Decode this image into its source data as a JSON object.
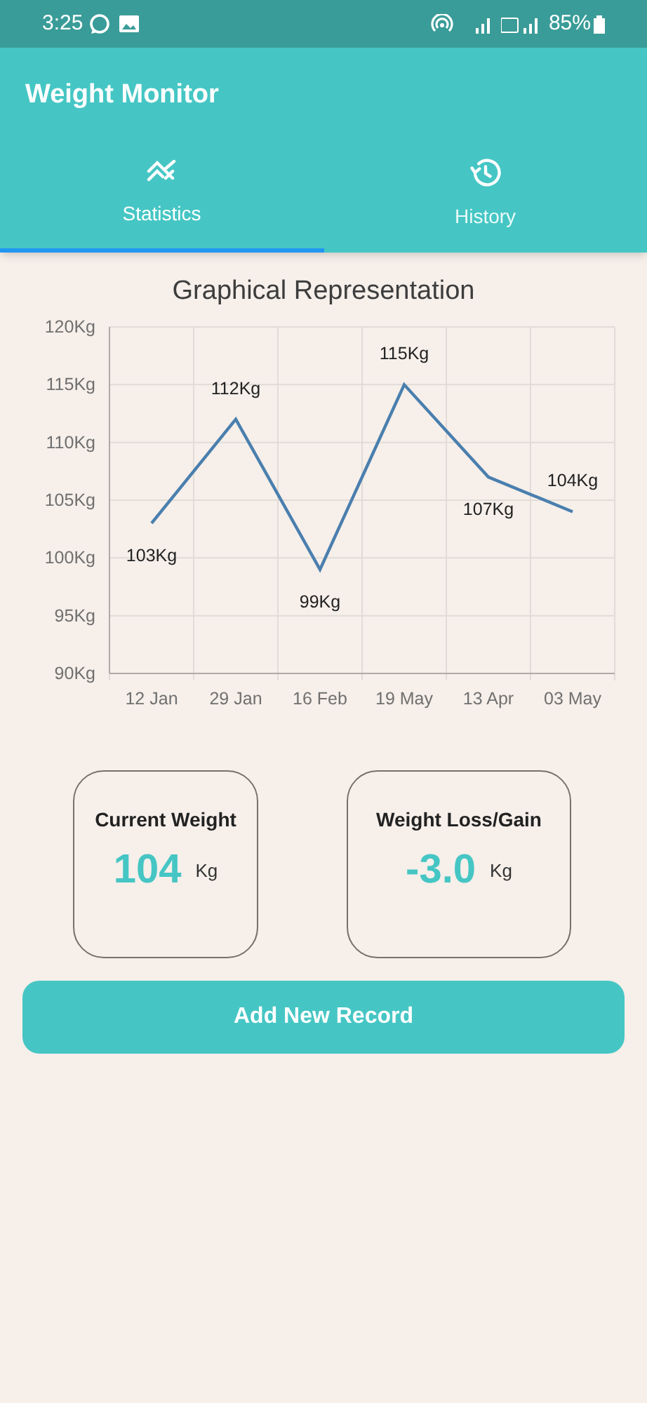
{
  "status_bar": {
    "time": "3:25",
    "battery": "85%"
  },
  "app_bar": {
    "title": "Weight Monitor"
  },
  "tabs": [
    {
      "label": "Statistics",
      "selected": true
    },
    {
      "label": "History",
      "selected": false
    }
  ],
  "chart_data": {
    "type": "line",
    "title": "Graphical Representation",
    "categories": [
      "12 Jan",
      "29 Jan",
      "16 Feb",
      "19 May",
      "13 Apr",
      "03 May"
    ],
    "series": [
      {
        "color": "#4a7fae",
        "values": [
          103,
          112,
          99,
          115,
          107,
          104
        ]
      }
    ],
    "grid": true,
    "ylim": [
      90,
      120
    ],
    "yticks": [
      {
        "value": 90,
        "label": "90Kg"
      },
      {
        "value": 95,
        "label": "95Kg"
      },
      {
        "value": 100,
        "label": "100Kg"
      },
      {
        "value": 105,
        "label": "105Kg"
      },
      {
        "value": 110,
        "label": "110Kg"
      },
      {
        "value": 115,
        "label": "115Kg"
      },
      {
        "value": 120,
        "label": "120Kg"
      }
    ],
    "value_labels": [
      "103Kg",
      "112Kg",
      "99Kg",
      "115Kg",
      "107Kg",
      "104Kg"
    ]
  },
  "cards": [
    {
      "title": "Current Weight",
      "value": "104",
      "unit": "Kg"
    },
    {
      "title": "Weight Loss/Gain",
      "value": "-3.0",
      "unit": "Kg"
    }
  ],
  "button": {
    "label": "Add New Record"
  }
}
